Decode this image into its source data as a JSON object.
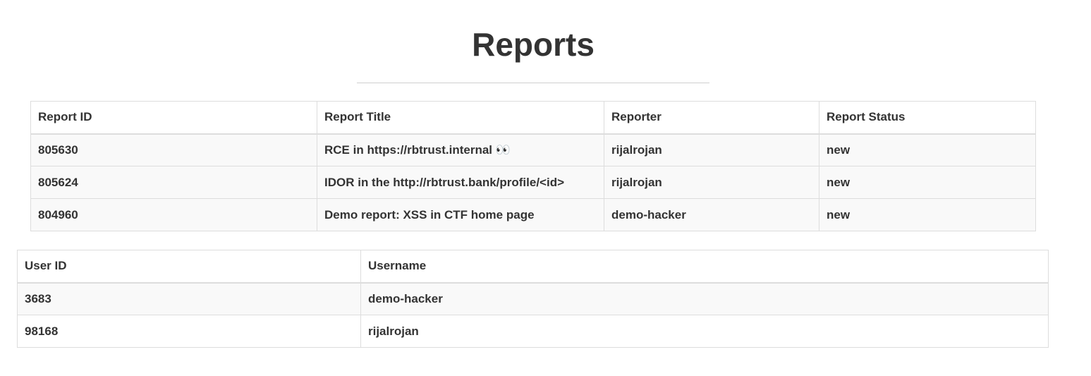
{
  "page": {
    "title": "Reports"
  },
  "reports_table": {
    "columns": [
      "Report ID",
      "Report Title",
      "Reporter",
      "Report Status"
    ],
    "rows": [
      [
        "805630",
        "RCE in https://rbtrust.internal 👀",
        "rijalrojan",
        "new"
      ],
      [
        "805624",
        "IDOR in the http://rbtrust.bank/profile/<id>",
        "rijalrojan",
        "new"
      ],
      [
        "804960",
        "Demo report: XSS in CTF home page",
        "demo-hacker",
        "new"
      ]
    ]
  },
  "users_table": {
    "columns": [
      "User ID",
      "Username"
    ],
    "rows": [
      [
        "3683",
        "demo-hacker"
      ],
      [
        "98168",
        "rijalrojan"
      ]
    ]
  },
  "colors": {
    "text": "#333333",
    "border": "#dddddd",
    "stripe": "#f9f9f9"
  }
}
